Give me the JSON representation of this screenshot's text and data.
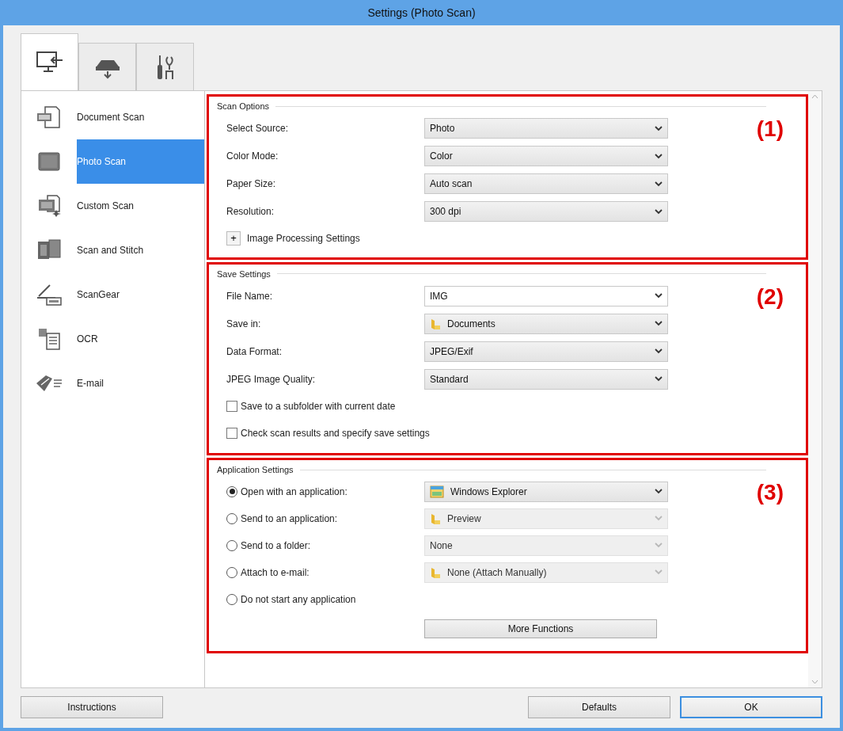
{
  "window": {
    "title": "Settings (Photo Scan)"
  },
  "tabs": [
    {
      "selected": true
    },
    {
      "selected": false
    },
    {
      "selected": false
    }
  ],
  "sidebar": {
    "items": [
      {
        "label": "Document Scan",
        "selected": false
      },
      {
        "label": "Photo Scan",
        "selected": true
      },
      {
        "label": "Custom Scan",
        "selected": false
      },
      {
        "label": "Scan and Stitch",
        "selected": false
      },
      {
        "label": "ScanGear",
        "selected": false
      },
      {
        "label": "OCR",
        "selected": false
      },
      {
        "label": "E-mail",
        "selected": false
      }
    ]
  },
  "sections": [
    {
      "title": "Scan Options",
      "marker": "(1)",
      "rows": [
        {
          "kind": "select",
          "label": "Select Source:",
          "value": "Photo",
          "disabled": false
        },
        {
          "kind": "select",
          "label": "Color Mode:",
          "value": "Color",
          "disabled": false
        },
        {
          "kind": "select",
          "label": "Paper Size:",
          "value": "Auto scan",
          "disabled": false
        },
        {
          "kind": "select",
          "label": "Resolution:",
          "value": "300 dpi",
          "disabled": false
        },
        {
          "kind": "expander",
          "label": "Image Processing Settings",
          "expanded": false,
          "symbol": "+"
        }
      ]
    },
    {
      "title": "Save Settings",
      "marker": "(2)",
      "rows": [
        {
          "kind": "select",
          "label": "File Name:",
          "value": "IMG",
          "disabled": false,
          "editable": true
        },
        {
          "kind": "folder_select",
          "label": "Save in:",
          "value": "Documents",
          "disabled": false
        },
        {
          "kind": "select",
          "label": "Data Format:",
          "value": "JPEG/Exif",
          "disabled": false
        },
        {
          "kind": "select",
          "label": "JPEG Image Quality:",
          "value": "Standard",
          "disabled": false
        },
        {
          "kind": "checkbox",
          "label": "Save to a subfolder with current date",
          "checked": false
        },
        {
          "kind": "checkbox",
          "label": "Check scan results and specify save settings",
          "checked": false
        }
      ]
    },
    {
      "title": "Application Settings",
      "marker": "(3)",
      "rows": [
        {
          "kind": "radio_app_select",
          "label": "Open with an application:",
          "selected": true,
          "value": "Windows Explorer",
          "disabled": false
        },
        {
          "kind": "radio_folder_select",
          "label": "Send to an application:",
          "selected": false,
          "value": "Preview",
          "disabled": true
        },
        {
          "kind": "radio_select",
          "label": "Send to a folder:",
          "selected": false,
          "value": "None",
          "disabled": true
        },
        {
          "kind": "radio_folder_select",
          "label": "Attach to e-mail:",
          "selected": false,
          "value": "None (Attach Manually)",
          "disabled": true
        },
        {
          "kind": "radio",
          "label": "Do not start any application",
          "selected": false
        },
        {
          "kind": "button",
          "label": "More Functions"
        }
      ]
    }
  ],
  "buttons": [
    {
      "label": "Instructions",
      "default": false
    },
    {
      "label": "Defaults",
      "default": false
    },
    {
      "label": "OK",
      "default": true
    }
  ]
}
